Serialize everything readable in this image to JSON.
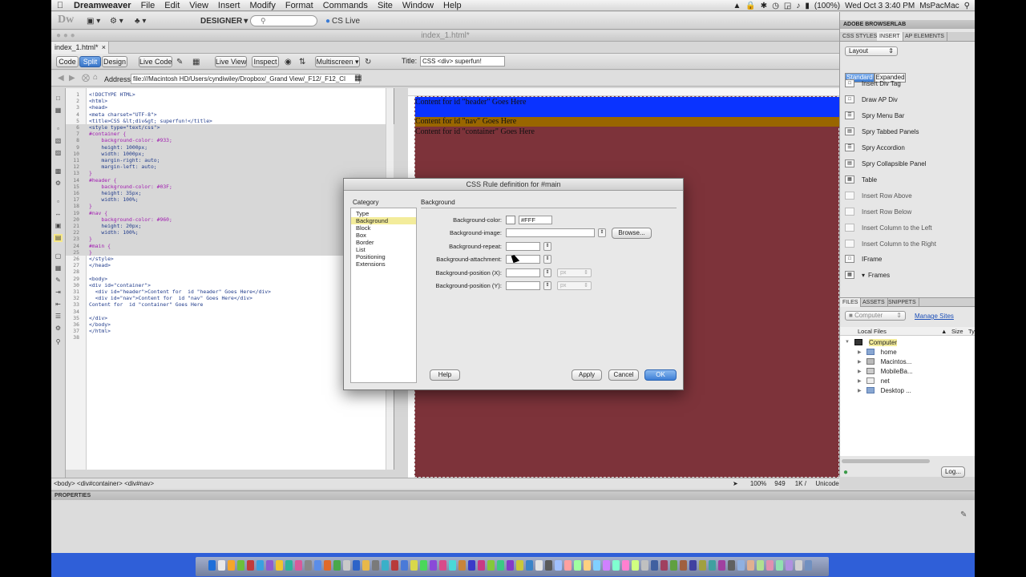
{
  "menubar": {
    "app": "Dreamweaver",
    "items": [
      "File",
      "Edit",
      "View",
      "Insert",
      "Modify",
      "Format",
      "Commands",
      "Site",
      "Window",
      "Help"
    ],
    "battery": "(100%)",
    "clock": "Wed Oct 3  3:40 PM",
    "user": "MsPacMac"
  },
  "apptoolbar": {
    "logo": "Dw",
    "workspace": "DESIGNER",
    "cslive": "CS Live"
  },
  "document": {
    "window_title": "index_1.html*",
    "tab": "index_1.html*",
    "tab_close": "×"
  },
  "doctoolbar": {
    "code": "Code",
    "split": "Split",
    "design": "Design",
    "live_code": "Live Code",
    "live_view": "Live View",
    "inspect": "Inspect",
    "multiscreen": "Multiscreen",
    "title_label": "Title:",
    "title_value": "CSS <div> superfun!"
  },
  "address": {
    "label": "Address:",
    "value": "file:///Macintosh HD/Users/cyndiwiley/Dropbox/_Grand View/_F12/_F12_Cl"
  },
  "code_lines": [
    {
      "n": "1",
      "t": "<!DOCTYPE HTML>",
      "hl": false
    },
    {
      "n": "2",
      "t": "<html>",
      "hl": false
    },
    {
      "n": "3",
      "t": "<head>",
      "hl": false
    },
    {
      "n": "4",
      "t": "<meta charset=\"UTF-8\">",
      "hl": false
    },
    {
      "n": "5",
      "t": "<title>CSS &lt;div&gt; superfun!</title>",
      "hl": false
    },
    {
      "n": "6",
      "t": "<style type=\"text/css\">",
      "hl": true
    },
    {
      "n": "7",
      "t": "#container {",
      "hl": true
    },
    {
      "n": "8",
      "t": "    background-color: #933;",
      "hl": true
    },
    {
      "n": "9",
      "t": "    height: 1000px;",
      "hl": true
    },
    {
      "n": "10",
      "t": "    width: 1000px;",
      "hl": true
    },
    {
      "n": "11",
      "t": "    margin-right: auto;",
      "hl": true
    },
    {
      "n": "12",
      "t": "    margin-left: auto;",
      "hl": true
    },
    {
      "n": "13",
      "t": "}",
      "hl": true
    },
    {
      "n": "14",
      "t": "#header {",
      "hl": true
    },
    {
      "n": "15",
      "t": "    background-color: #03F;",
      "hl": true
    },
    {
      "n": "16",
      "t": "    height: 35px;",
      "hl": true
    },
    {
      "n": "17",
      "t": "    width: 100%;",
      "hl": true
    },
    {
      "n": "18",
      "t": "}",
      "hl": true
    },
    {
      "n": "19",
      "t": "#nav {",
      "hl": true
    },
    {
      "n": "20",
      "t": "    background-color: #960;",
      "hl": true
    },
    {
      "n": "21",
      "t": "    height: 20px;",
      "hl": true
    },
    {
      "n": "22",
      "t": "    width: 100%;",
      "hl": true
    },
    {
      "n": "23",
      "t": "}",
      "hl": true
    },
    {
      "n": "24",
      "t": "#main {",
      "hl": true
    },
    {
      "n": "25",
      "t": "}",
      "hl": true
    },
    {
      "n": "26",
      "t": "</style>",
      "hl": false
    },
    {
      "n": "27",
      "t": "</head>",
      "hl": false
    },
    {
      "n": "28",
      "t": "",
      "hl": false
    },
    {
      "n": "29",
      "t": "<body>",
      "hl": false
    },
    {
      "n": "30",
      "t": "<div id=\"container\">",
      "hl": false
    },
    {
      "n": "31",
      "t": "  <div id=\"header\">Content for  id \"header\" Goes Here</div>",
      "hl": false
    },
    {
      "n": "32",
      "t": "  <div id=\"nav\">Content for  id \"nav\" Goes Here</div>",
      "hl": false
    },
    {
      "n": "33",
      "t": "Content for  id \"container\" Goes Here",
      "hl": false
    },
    {
      "n": "34",
      "t": "",
      "hl": false
    },
    {
      "n": "35",
      "t": "</div>",
      "hl": false
    },
    {
      "n": "36",
      "t": "</body>",
      "hl": false
    },
    {
      "n": "37",
      "t": "</html>",
      "hl": false
    },
    {
      "n": "38",
      "t": "",
      "hl": false
    }
  ],
  "design_view": {
    "header_text": "Content for id \"header\" Goes Here",
    "nav_text": "Content for id \"nav\" Goes Here",
    "container_text": "Content for id \"container\" Goes Here",
    "colors": {
      "header": "#0033FF",
      "nav": "#996600",
      "container": "#7D333A"
    }
  },
  "doc_status": {
    "tag_selector": "<body> <div#container> <div#nav>",
    "zoom": "100%",
    "size": "949 x 694",
    "download": "1K / 1 sec",
    "encoding": "Unicode 6.0 UTF-8"
  },
  "properties": {
    "title": "PROPERTIES"
  },
  "right_panel": {
    "browserlab": "ADOBE BROWSERLAB",
    "tabs": [
      "CSS STYLES",
      "INSERT",
      "AP ELEMENTS"
    ],
    "layout_select": "Layout",
    "standard": "Standard",
    "expanded": "Expanded",
    "insert_items": [
      "Insert Div Tag",
      "Draw AP Div",
      "Spry Menu Bar",
      "Spry Tabbed Panels",
      "Spry Accordion",
      "Spry Collapsible Panel",
      "Table",
      "Insert Row Above",
      "Insert Row Below",
      "Insert Column to the Left",
      "Insert Column to the Right",
      "IFrame",
      "Frames"
    ],
    "file_tabs": [
      "FILES",
      "ASSETS",
      "SNIPPETS"
    ],
    "location_select": "Computer",
    "manage_sites": "Manage Sites",
    "col_local": "Local Files",
    "col_size": "Size",
    "col_type": "Ty",
    "tree": [
      "Computer",
      "home",
      "Macintos...",
      "MobileBa...",
      "net",
      "Desktop ..."
    ],
    "log_button": "Log..."
  },
  "dialog": {
    "title": "CSS Rule definition for #main",
    "category_label": "Category",
    "categories": [
      "Type",
      "Background",
      "Block",
      "Box",
      "Border",
      "List",
      "Positioning",
      "Extensions"
    ],
    "selected_category": "Background",
    "section": "Background",
    "fields": {
      "bgcolor_label": "Background-color:",
      "bgcolor_value": "#FFF",
      "bgimage_label": "Background-image:",
      "browse": "Browse...",
      "repeat_label": "Background-repeat:",
      "attach_label": "Background-attachment:",
      "posx_label": "Background-position (X):",
      "posy_label": "Background-position (Y):",
      "unit": "px"
    },
    "help": "Help",
    "apply": "Apply",
    "cancel": "Cancel",
    "ok": "OK"
  }
}
